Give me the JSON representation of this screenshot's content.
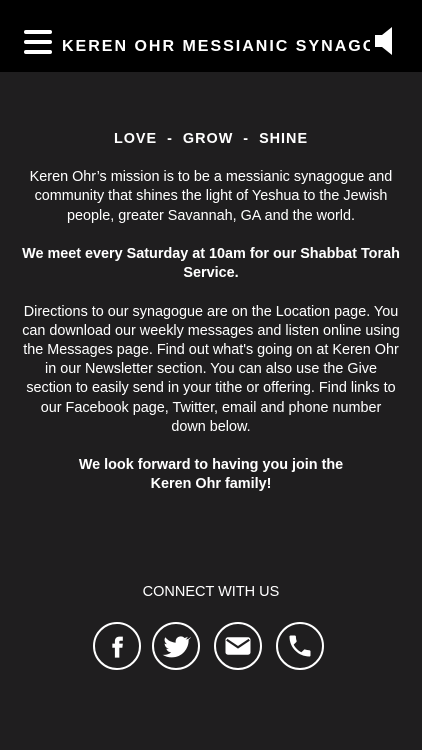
{
  "header": {
    "title": "KEREN OHR MESSIANIC SYNAGOGUE",
    "menu_icon": "hamburger-menu-icon",
    "speaker_icon": "speaker-icon"
  },
  "main": {
    "tagline": "LOVE  -  GROW  -  SHINE",
    "mission_text": "Keren Ohr’s mission is to be a messianic synagogue and community that shines the light of Yeshua to the Jewish people, greater Savannah, GA and the world.",
    "meeting_text": "We meet every Saturday at 10am for our Shabbat Torah Service.",
    "directions_text": "Directions to our synagogue are on the Location page.  You can download our weekly messages and listen online using the Messages page.  Find out what's going on at Keren Ohr in our Newsletter section.  You can also use the Give section to easily send in your tithe or offering.  Find links to our Facebook page, Twitter, email and phone number down below.",
    "closing_line1": "We look forward to having you join the",
    "closing_line2": "Keren Ohr family!"
  },
  "connect": {
    "heading": "CONNECT WITH US",
    "buttons": [
      "facebook-icon",
      "twitter-icon",
      "email-icon",
      "phone-icon"
    ]
  },
  "colors": {
    "header_bg": "#000000",
    "page_bg": "#1f1e1f",
    "text": "#ffffff"
  }
}
